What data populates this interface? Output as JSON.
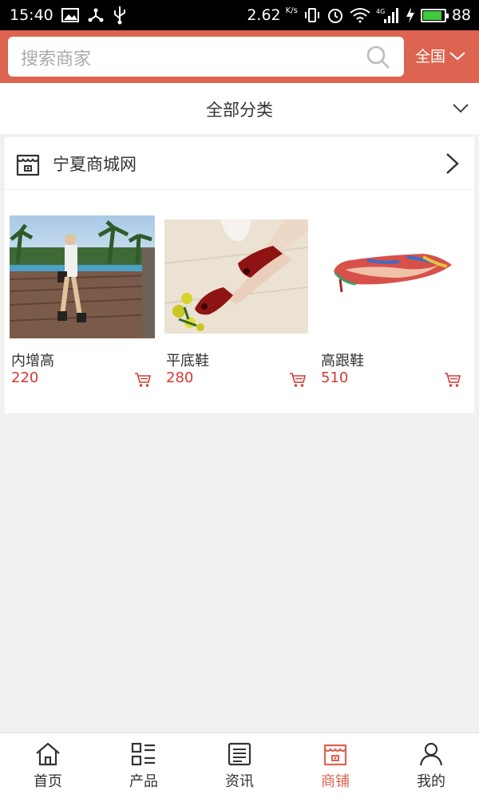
{
  "status_bar": {
    "time": "15:40",
    "speed": "2.62",
    "speed_unit": "K/s",
    "network": "4G",
    "battery": "88",
    "battery_level": 0.88
  },
  "header": {
    "search_placeholder": "搜索商家",
    "region": "全国"
  },
  "category": {
    "label": "全部分类"
  },
  "shop": {
    "name": "宁夏商城网"
  },
  "products": [
    {
      "name": "内增高",
      "price": "220"
    },
    {
      "name": "平底鞋",
      "price": "280"
    },
    {
      "name": "高跟鞋",
      "price": "510"
    }
  ],
  "bottom_nav": [
    {
      "label": "首页",
      "icon": "home-icon"
    },
    {
      "label": "产品",
      "icon": "grid-list-icon"
    },
    {
      "label": "资讯",
      "icon": "news-icon"
    },
    {
      "label": "商铺",
      "icon": "shop-icon",
      "active": true
    },
    {
      "label": "我的",
      "icon": "person-icon"
    }
  ],
  "colors": {
    "accent": "#dc6450",
    "price": "#d63a35",
    "background": "#f1f1f1"
  }
}
